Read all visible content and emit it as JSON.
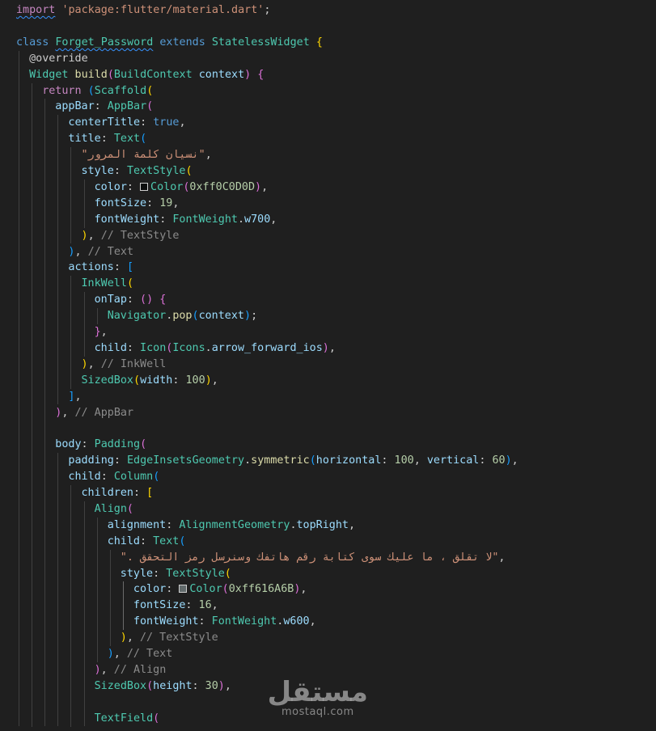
{
  "colors": {
    "background": "#1f1f1f",
    "keyword": "#569cd6",
    "control": "#c586c0",
    "type": "#4ec9b0",
    "function": "#dcdcaa",
    "property": "#9cdcfe",
    "string": "#ce9178",
    "number": "#b5cea8",
    "comment": "#8b8b8b",
    "punct": "#cccccc",
    "bracket1": "#ffd700",
    "bracket2": "#da70d6",
    "bracket3": "#179fff"
  },
  "editor": {
    "lines": [
      {
        "indent": 0,
        "tokens": [
          [
            "import",
            "control",
            "squiggle"
          ],
          [
            " ",
            "punct"
          ],
          [
            "'package:flutter/material.dart'",
            "string"
          ],
          [
            ";",
            "punct"
          ]
        ]
      },
      {
        "indent": 0,
        "tokens": []
      },
      {
        "indent": 0,
        "tokens": [
          [
            "class",
            "keyword"
          ],
          [
            " ",
            "punct"
          ],
          [
            "Forget_Password",
            "type",
            "squiggle"
          ],
          [
            " ",
            "punct"
          ],
          [
            "extends",
            "keyword"
          ],
          [
            " ",
            "punct"
          ],
          [
            "StatelessWidget",
            "type"
          ],
          [
            " ",
            "punct"
          ],
          [
            "{",
            "bracket1"
          ]
        ]
      },
      {
        "indent": 1,
        "tokens": [
          [
            "@override",
            "punct"
          ]
        ]
      },
      {
        "indent": 1,
        "tokens": [
          [
            "Widget",
            "type"
          ],
          [
            " ",
            "punct"
          ],
          [
            "build",
            "function"
          ],
          [
            "(",
            "bracket2"
          ],
          [
            "BuildContext",
            "type"
          ],
          [
            " ",
            "punct"
          ],
          [
            "context",
            "property"
          ],
          [
            ")",
            "bracket2"
          ],
          [
            " ",
            "punct"
          ],
          [
            "{",
            "bracket2"
          ]
        ]
      },
      {
        "indent": 2,
        "tokens": [
          [
            "return",
            "control"
          ],
          [
            " ",
            "punct"
          ],
          [
            "(",
            "bracket3"
          ],
          [
            "Scaffold",
            "type"
          ],
          [
            "(",
            "bracket1"
          ]
        ]
      },
      {
        "indent": 3,
        "tokens": [
          [
            "appBar",
            "property"
          ],
          [
            ": ",
            "punct"
          ],
          [
            "AppBar",
            "type"
          ],
          [
            "(",
            "bracket2"
          ]
        ]
      },
      {
        "indent": 4,
        "tokens": [
          [
            "centerTitle",
            "property"
          ],
          [
            ": ",
            "punct"
          ],
          [
            "true",
            "keyword"
          ],
          [
            ",",
            "punct"
          ]
        ]
      },
      {
        "indent": 4,
        "tokens": [
          [
            "title",
            "property"
          ],
          [
            ": ",
            "punct"
          ],
          [
            "Text",
            "type"
          ],
          [
            "(",
            "bracket3"
          ]
        ]
      },
      {
        "indent": 5,
        "tokens": [
          [
            "\"نسيان كلمة المرور\"",
            "string",
            "ar"
          ],
          [
            ",",
            "punct"
          ]
        ]
      },
      {
        "indent": 5,
        "tokens": [
          [
            "style",
            "property"
          ],
          [
            ": ",
            "punct"
          ],
          [
            "TextStyle",
            "type"
          ],
          [
            "(",
            "bracket1"
          ]
        ]
      },
      {
        "indent": 6,
        "tokens": [
          [
            "color",
            "property"
          ],
          [
            ": ",
            "punct"
          ],
          [
            "#0C0D0D",
            "swatch"
          ],
          [
            "Color",
            "type"
          ],
          [
            "(",
            "bracket2"
          ],
          [
            "0xff0C0D0D",
            "number"
          ],
          [
            ")",
            "bracket2"
          ],
          [
            ",",
            "punct"
          ]
        ]
      },
      {
        "indent": 6,
        "tokens": [
          [
            "fontSize",
            "property"
          ],
          [
            ": ",
            "punct"
          ],
          [
            "19",
            "number"
          ],
          [
            ",",
            "punct"
          ]
        ]
      },
      {
        "indent": 6,
        "tokens": [
          [
            "fontWeight",
            "property"
          ],
          [
            ": ",
            "punct"
          ],
          [
            "FontWeight",
            "type"
          ],
          [
            ".",
            "punct"
          ],
          [
            "w700",
            "property"
          ],
          [
            ",",
            "punct"
          ]
        ]
      },
      {
        "indent": 5,
        "tokens": [
          [
            ")",
            "bracket1"
          ],
          [
            ", ",
            "punct"
          ],
          [
            "// TextStyle",
            "comment"
          ]
        ]
      },
      {
        "indent": 4,
        "tokens": [
          [
            ")",
            "bracket3"
          ],
          [
            ", ",
            "punct"
          ],
          [
            "// Text",
            "comment"
          ]
        ]
      },
      {
        "indent": 4,
        "tokens": [
          [
            "actions",
            "property"
          ],
          [
            ": ",
            "punct"
          ],
          [
            "[",
            "bracket3"
          ]
        ]
      },
      {
        "indent": 5,
        "tokens": [
          [
            "InkWell",
            "type"
          ],
          [
            "(",
            "bracket1"
          ]
        ]
      },
      {
        "indent": 6,
        "tokens": [
          [
            "onTap",
            "property"
          ],
          [
            ": ",
            "punct"
          ],
          [
            "()",
            "bracket2"
          ],
          [
            " ",
            "punct"
          ],
          [
            "{",
            "bracket2"
          ]
        ]
      },
      {
        "indent": 7,
        "tokens": [
          [
            "Navigator",
            "type"
          ],
          [
            ".",
            "punct"
          ],
          [
            "pop",
            "function"
          ],
          [
            "(",
            "bracket3"
          ],
          [
            "context",
            "property"
          ],
          [
            ")",
            "bracket3"
          ],
          [
            ";",
            "punct"
          ]
        ]
      },
      {
        "indent": 6,
        "tokens": [
          [
            "}",
            "bracket2"
          ],
          [
            ",",
            "punct"
          ]
        ]
      },
      {
        "indent": 6,
        "tokens": [
          [
            "child",
            "property"
          ],
          [
            ": ",
            "punct"
          ],
          [
            "Icon",
            "type"
          ],
          [
            "(",
            "bracket2"
          ],
          [
            "Icons",
            "type"
          ],
          [
            ".",
            "punct"
          ],
          [
            "arrow_forward_ios",
            "property"
          ],
          [
            ")",
            "bracket2"
          ],
          [
            ",",
            "punct"
          ]
        ]
      },
      {
        "indent": 5,
        "tokens": [
          [
            ")",
            "bracket1"
          ],
          [
            ", ",
            "punct"
          ],
          [
            "// InkWell",
            "comment"
          ]
        ]
      },
      {
        "indent": 5,
        "tokens": [
          [
            "SizedBox",
            "type"
          ],
          [
            "(",
            "bracket1"
          ],
          [
            "width",
            "property"
          ],
          [
            ": ",
            "punct"
          ],
          [
            "100",
            "number"
          ],
          [
            ")",
            "bracket1"
          ],
          [
            ",",
            "punct"
          ]
        ]
      },
      {
        "indent": 4,
        "tokens": [
          [
            "]",
            "bracket3"
          ],
          [
            ",",
            "punct"
          ]
        ]
      },
      {
        "indent": 3,
        "tokens": [
          [
            ")",
            "bracket2"
          ],
          [
            ", ",
            "punct"
          ],
          [
            "// AppBar",
            "comment"
          ]
        ]
      },
      {
        "indent": 0,
        "tokens": []
      },
      {
        "indent": 3,
        "tokens": [
          [
            "body",
            "property"
          ],
          [
            ": ",
            "punct"
          ],
          [
            "Padding",
            "type"
          ],
          [
            "(",
            "bracket2"
          ]
        ]
      },
      {
        "indent": 4,
        "tokens": [
          [
            "padding",
            "property"
          ],
          [
            ": ",
            "punct"
          ],
          [
            "EdgeInsetsGeometry",
            "type"
          ],
          [
            ".",
            "punct"
          ],
          [
            "symmetric",
            "function"
          ],
          [
            "(",
            "bracket3"
          ],
          [
            "horizontal",
            "property"
          ],
          [
            ": ",
            "punct"
          ],
          [
            "100",
            "number"
          ],
          [
            ", ",
            "punct"
          ],
          [
            "vertical",
            "property"
          ],
          [
            ": ",
            "punct"
          ],
          [
            "60",
            "number"
          ],
          [
            ")",
            "bracket3"
          ],
          [
            ",",
            "punct"
          ]
        ]
      },
      {
        "indent": 4,
        "tokens": [
          [
            "child",
            "property"
          ],
          [
            ": ",
            "punct"
          ],
          [
            "Column",
            "type"
          ],
          [
            "(",
            "bracket3"
          ]
        ]
      },
      {
        "indent": 5,
        "tokens": [
          [
            "children",
            "property"
          ],
          [
            ": ",
            "punct"
          ],
          [
            "[",
            "bracket1"
          ]
        ]
      },
      {
        "indent": 6,
        "tokens": [
          [
            "Align",
            "type"
          ],
          [
            "(",
            "bracket2"
          ]
        ]
      },
      {
        "indent": 7,
        "tokens": [
          [
            "alignment",
            "property"
          ],
          [
            ": ",
            "punct"
          ],
          [
            "AlignmentGeometry",
            "type"
          ],
          [
            ".",
            "punct"
          ],
          [
            "topRight",
            "property"
          ],
          [
            ",",
            "punct"
          ]
        ]
      },
      {
        "indent": 7,
        "tokens": [
          [
            "child",
            "property"
          ],
          [
            ": ",
            "punct"
          ],
          [
            "Text",
            "type"
          ],
          [
            "(",
            "bracket3"
          ]
        ]
      },
      {
        "indent": 8,
        "tokens": [
          [
            "\"لا تقلق ، ما عليك سوى كتابة رقم هاتفك وسنرسل رمز التحقق .\"",
            "string",
            "ar"
          ],
          [
            ",",
            "punct"
          ]
        ]
      },
      {
        "indent": 8,
        "tokens": [
          [
            "style",
            "property"
          ],
          [
            ": ",
            "punct"
          ],
          [
            "TextStyle",
            "type"
          ],
          [
            "(",
            "bracket1"
          ]
        ]
      },
      {
        "indent": 9,
        "tokens": [
          [
            "color",
            "property"
          ],
          [
            ": ",
            "punct"
          ],
          [
            "#616A6B",
            "swatch"
          ],
          [
            "Color",
            "type"
          ],
          [
            "(",
            "bracket2"
          ],
          [
            "0xff616A6B",
            "number"
          ],
          [
            ")",
            "bracket2"
          ],
          [
            ",",
            "punct"
          ]
        ]
      },
      {
        "indent": 9,
        "tokens": [
          [
            "fontSize",
            "property"
          ],
          [
            ": ",
            "punct"
          ],
          [
            "16",
            "number"
          ],
          [
            ",",
            "punct"
          ]
        ]
      },
      {
        "indent": 9,
        "tokens": [
          [
            "fontWeight",
            "property"
          ],
          [
            ": ",
            "punct"
          ],
          [
            "FontWeight",
            "type"
          ],
          [
            ".",
            "punct"
          ],
          [
            "w600",
            "property"
          ],
          [
            ",",
            "punct"
          ]
        ]
      },
      {
        "indent": 8,
        "tokens": [
          [
            ")",
            "bracket1"
          ],
          [
            ", ",
            "punct"
          ],
          [
            "// TextStyle",
            "comment"
          ]
        ]
      },
      {
        "indent": 7,
        "tokens": [
          [
            ")",
            "bracket3"
          ],
          [
            ", ",
            "punct"
          ],
          [
            "// Text",
            "comment"
          ]
        ]
      },
      {
        "indent": 6,
        "tokens": [
          [
            ")",
            "bracket2"
          ],
          [
            ", ",
            "punct"
          ],
          [
            "// Align",
            "comment"
          ]
        ]
      },
      {
        "indent": 6,
        "tokens": [
          [
            "SizedBox",
            "type"
          ],
          [
            "(",
            "bracket2"
          ],
          [
            "height",
            "property"
          ],
          [
            ": ",
            "punct"
          ],
          [
            "30",
            "number"
          ],
          [
            ")",
            "bracket2"
          ],
          [
            ",",
            "punct"
          ]
        ]
      },
      {
        "indent": 0,
        "tokens": []
      },
      {
        "indent": 6,
        "tokens": [
          [
            "TextField",
            "type"
          ],
          [
            "(",
            "bracket2"
          ]
        ]
      }
    ]
  },
  "watermark": {
    "logo": "مستقل",
    "url": "mostaql.com"
  }
}
